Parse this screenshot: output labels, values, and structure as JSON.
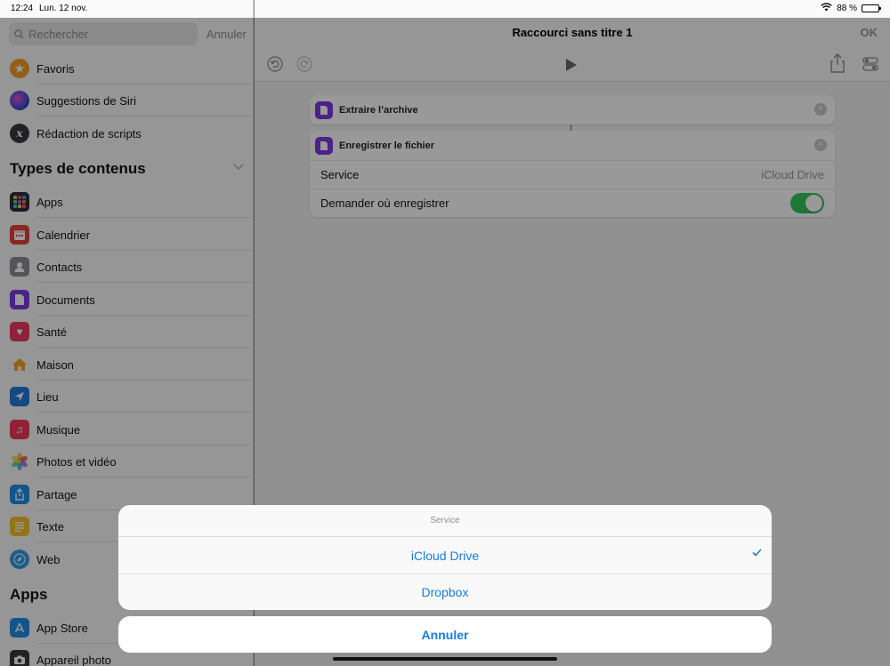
{
  "status": {
    "time": "12:24",
    "date": "Lun. 12 nov.",
    "battery": "88 %"
  },
  "sidebar": {
    "search_placeholder": "Rechercher",
    "search_cancel": "Annuler",
    "favorites": [
      {
        "label": "Favoris",
        "icon": "star-icon",
        "color": "#f0a12a"
      },
      {
        "label": "Suggestions de Siri",
        "icon": "siri-icon",
        "color": "#3a4fd8"
      },
      {
        "label": "Rédaction de scripts",
        "icon": "scripting-icon",
        "color": "#3a3a3c"
      }
    ],
    "section_types": "Types de contenus",
    "types": [
      {
        "label": "Apps",
        "icon": "apps-grid-icon",
        "color": "#2c2c3a"
      },
      {
        "label": "Calendrier",
        "icon": "calendar-icon",
        "color": "#e5413b"
      },
      {
        "label": "Contacts",
        "icon": "contacts-icon",
        "color": "#8e8e93"
      },
      {
        "label": "Documents",
        "icon": "document-icon",
        "color": "#7e3be0"
      },
      {
        "label": "Santé",
        "icon": "heart-icon",
        "color": "#f0395c"
      },
      {
        "label": "Maison",
        "icon": "home-icon",
        "color": "#f4a326"
      },
      {
        "label": "Lieu",
        "icon": "location-arrow-icon",
        "color": "#1f7ae0"
      },
      {
        "label": "Musique",
        "icon": "music-note-icon",
        "color": "#f0395c"
      },
      {
        "label": "Photos et vidéo",
        "icon": "photos-flower-icon",
        "color": "#f39c2a"
      },
      {
        "label": "Partage",
        "icon": "share-icon",
        "color": "#1f8ee8"
      },
      {
        "label": "Texte",
        "icon": "text-lines-icon",
        "color": "#f2c230"
      },
      {
        "label": "Web",
        "icon": "safari-compass-icon",
        "color": "#2f9be8"
      }
    ],
    "section_apps": "Apps",
    "apps": [
      {
        "label": "App Store",
        "icon": "app-store-icon",
        "color": "#1f8ee8"
      },
      {
        "label": "Appareil photo",
        "icon": "camera-icon",
        "color": "#3a3a3c"
      }
    ]
  },
  "editor": {
    "title": "Raccourci sans titre 1",
    "done": "OK",
    "actions": [
      {
        "title": "Extraire l’archive"
      },
      {
        "title": "Enregistrer le fichier",
        "rows": [
          {
            "label": "Service",
            "value": "iCloud Drive"
          },
          {
            "label": "Demander où enregistrer",
            "toggle": true
          }
        ]
      }
    ]
  },
  "sheet": {
    "title": "Service",
    "options": [
      {
        "label": "iCloud Drive",
        "selected": true
      },
      {
        "label": "Dropbox",
        "selected": false
      }
    ],
    "cancel": "Annuler",
    "accent": "#157ddb"
  }
}
